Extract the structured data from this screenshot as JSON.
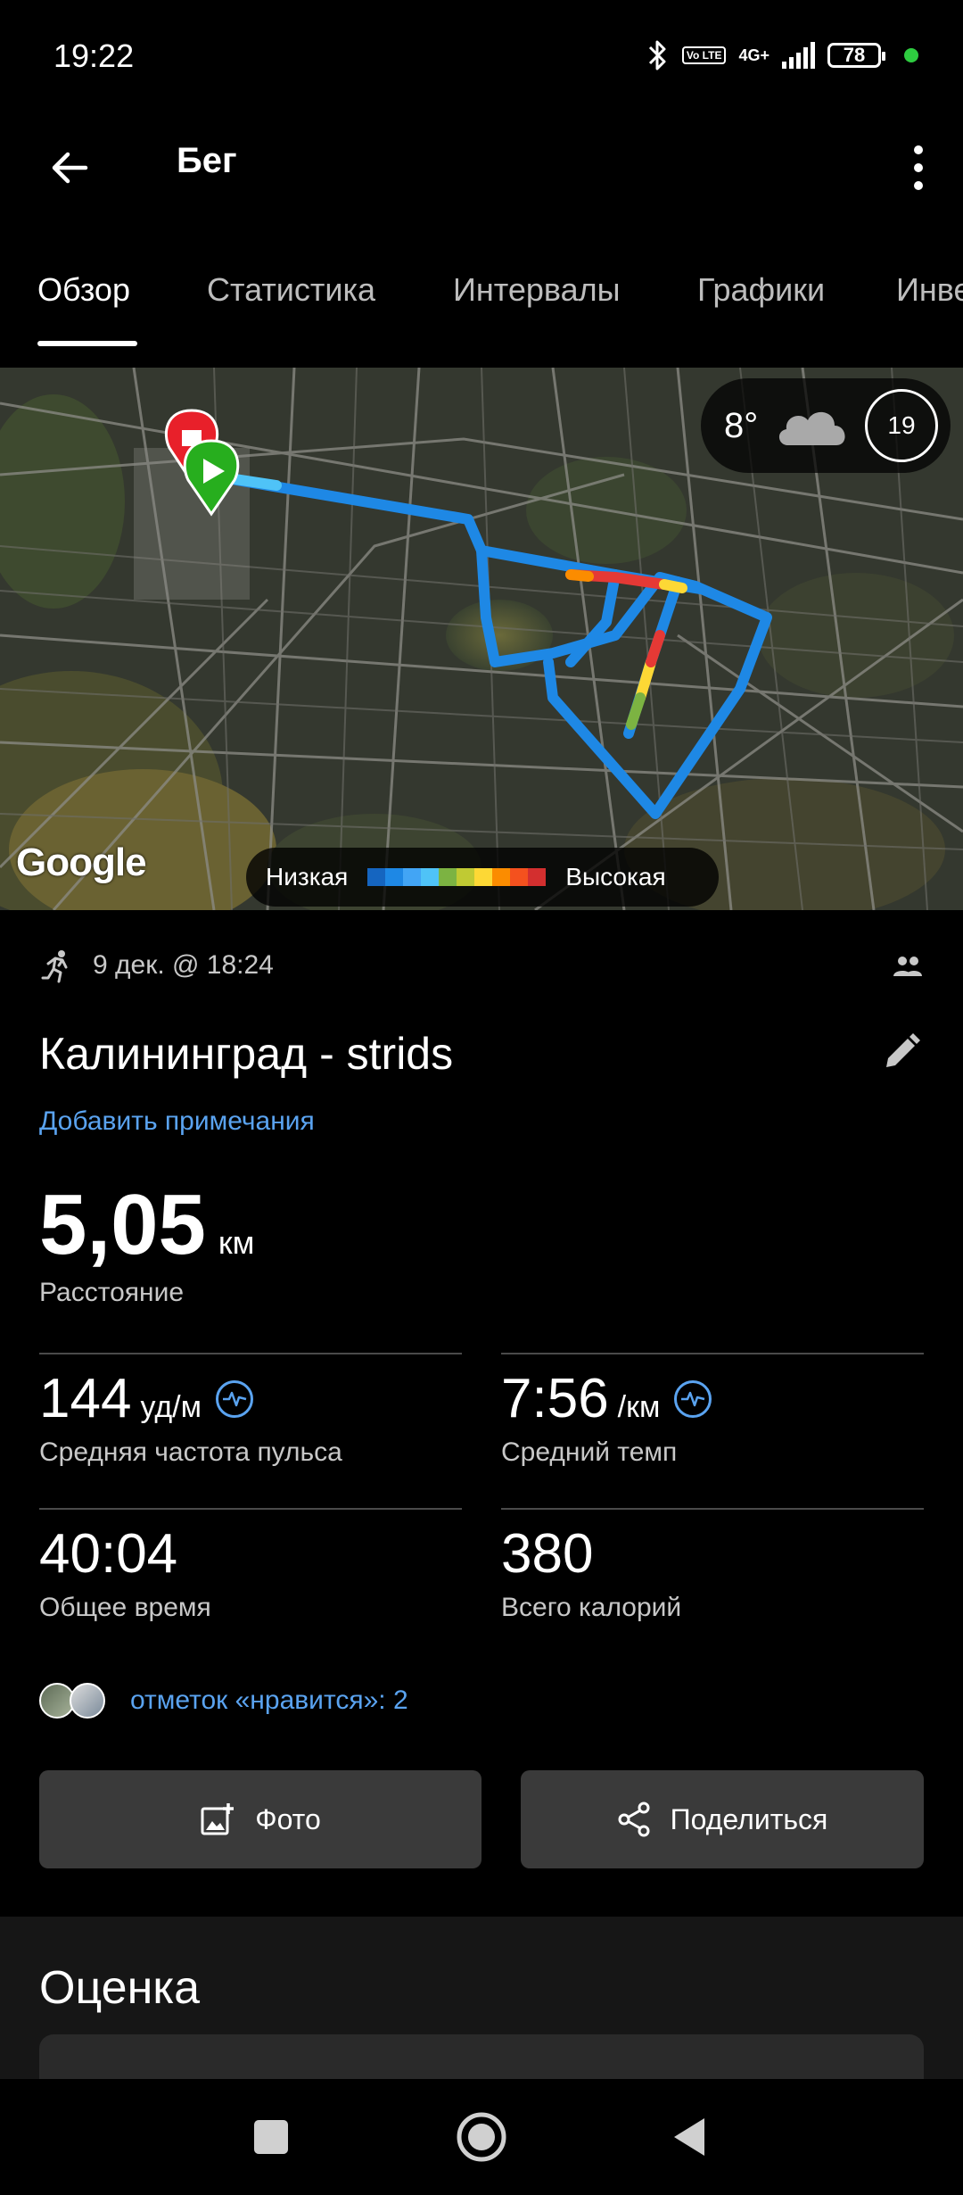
{
  "status_bar": {
    "time": "19:22",
    "network": "4G+",
    "volte": "Vo LTE",
    "battery": "78"
  },
  "app_bar": {
    "title": "Бег"
  },
  "tabs": [
    {
      "label": "Обзор",
      "active": true
    },
    {
      "label": "Статистика",
      "active": false
    },
    {
      "label": "Интервалы",
      "active": false
    },
    {
      "label": "Графики",
      "active": false
    },
    {
      "label": "Инвентарь",
      "active": false
    }
  ],
  "map": {
    "weather_temp": "8°",
    "weather_hour": "19",
    "provider_logo": "Google",
    "legend_low": "Низкая",
    "legend_high": "Высокая",
    "legend_colors": [
      "#1565c0",
      "#1e88e5",
      "#42a5f5",
      "#4fc3f7",
      "#7cb342",
      "#c0ca33",
      "#fdd835",
      "#fb8c00",
      "#f4511e",
      "#d32f2f"
    ]
  },
  "activity": {
    "date_time": "9 дек. @ 18:24",
    "title": "Калининград - strids",
    "add_notes": "Добавить примечания",
    "distance_value": "5,05",
    "distance_unit": "км",
    "distance_label": "Расстояние"
  },
  "stats": [
    {
      "value": "144",
      "unit": "уд/м",
      "label": "Средняя частота пульса",
      "has_icon": true
    },
    {
      "value": "7:56",
      "unit": "/км",
      "label": "Средний темп",
      "has_icon": true
    },
    {
      "value": "40:04",
      "unit": "",
      "label": "Общее время",
      "has_icon": false
    },
    {
      "value": "380",
      "unit": "",
      "label": "Всего калорий",
      "has_icon": false
    }
  ],
  "likes": {
    "text": "отметок «нравится»: 2"
  },
  "buttons": {
    "photo": "Фото",
    "share": "Поделиться"
  },
  "rating": {
    "title": "Оценка"
  },
  "colors": {
    "accent_link": "#5aa3f0",
    "button_bg": "#3a3a3a",
    "start_marker": "#27ae1e",
    "end_marker": "#e8202a"
  }
}
